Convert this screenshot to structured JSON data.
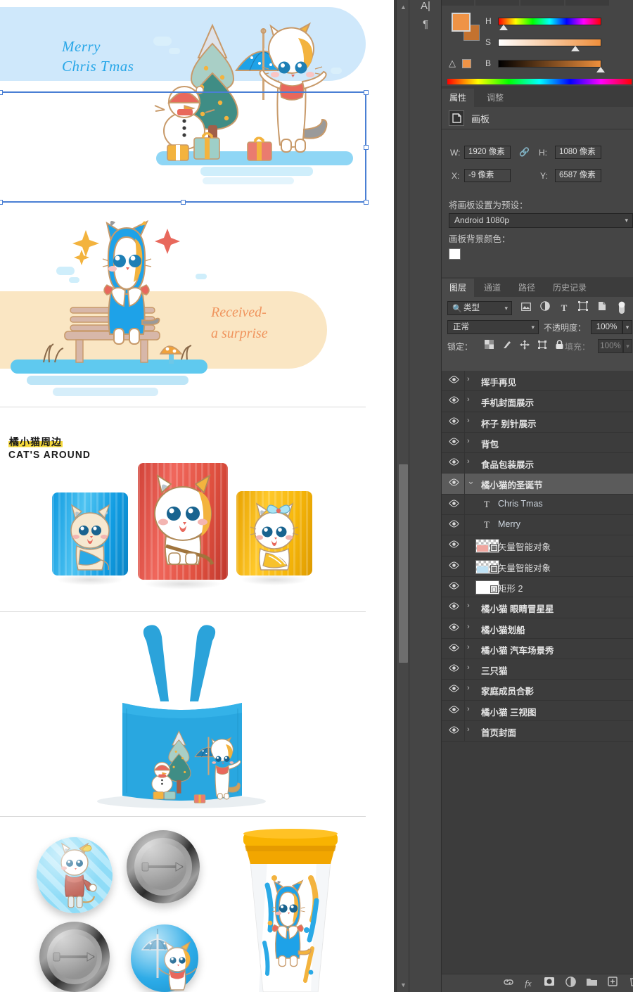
{
  "app": "Adobe Photoshop",
  "dock": {
    "items": [
      {
        "name": "character-panel",
        "glyph": "A|"
      },
      {
        "name": "paragraph-panel",
        "glyph": "¶"
      }
    ]
  },
  "color_panel": {
    "foreground_hex": "#ef9346",
    "background_hex": "#c4722f",
    "out_of_gamut_hex": "#ef9346",
    "channels": [
      {
        "label": "H",
        "value": "24",
        "pct": 7
      },
      {
        "label": "S",
        "value": "75",
        "pct": 75
      },
      {
        "label": "B",
        "value": "100",
        "pct": 100
      }
    ]
  },
  "properties": {
    "tabs": [
      {
        "label": "属性",
        "active": true
      },
      {
        "label": "调整",
        "active": false
      }
    ],
    "header": "画板",
    "fields": {
      "w_label": "W:",
      "w_value": "1920 像素",
      "h_label": "H:",
      "h_value": "1080 像素",
      "x_label": "X:",
      "x_value": "-9 像素",
      "y_label": "Y:",
      "y_value": "6587 像素"
    },
    "preset_label": "将画板设置为预设：",
    "preset_value": "Android 1080p",
    "bgcolor_label": "画板背景颜色：",
    "bgcolor_hex": "#ffffff"
  },
  "layers_panel": {
    "tabs": [
      {
        "label": "图层",
        "active": true
      },
      {
        "label": "通道",
        "active": false
      },
      {
        "label": "路径",
        "active": false
      },
      {
        "label": "历史记录",
        "active": false
      }
    ],
    "filter_value": "类型",
    "filter_icons": [
      "image-filter-icon",
      "adjustment-filter-icon",
      "type-filter-icon",
      "shape-filter-icon",
      "smart-object-filter-icon",
      "toggle-filter-icon"
    ],
    "blend_mode": "正常",
    "opacity_label": "不透明度：",
    "opacity_value": "100%",
    "lock_label": "锁定：",
    "lock_icons": [
      "lock-transparent-icon",
      "lock-image-icon",
      "lock-position-icon",
      "lock-artboard-icon",
      "lock-all-icon"
    ],
    "fill_label": "填充：",
    "fill_value": "100%",
    "rows": [
      {
        "name": "挥手再见",
        "kind": "group",
        "expanded": false,
        "selected": false,
        "visible": true
      },
      {
        "name": "手机封面展示",
        "kind": "group",
        "expanded": false,
        "selected": false,
        "visible": true
      },
      {
        "name": "杯子 别针展示",
        "kind": "group",
        "expanded": false,
        "selected": false,
        "visible": true
      },
      {
        "name": "背包",
        "kind": "group",
        "expanded": false,
        "selected": false,
        "visible": true
      },
      {
        "name": "食品包装展示",
        "kind": "group",
        "expanded": false,
        "selected": false,
        "visible": true
      },
      {
        "name": "橘小猫的圣诞节",
        "kind": "group",
        "expanded": true,
        "selected": true,
        "visible": true
      },
      {
        "name": "Chris Tmas",
        "kind": "text",
        "selected": false,
        "visible": true
      },
      {
        "name": "Merry",
        "kind": "text",
        "selected": false,
        "visible": true
      },
      {
        "name": "矢量智能对象",
        "kind": "smart-object",
        "selected": false,
        "visible": true
      },
      {
        "name": "矢量智能对象",
        "kind": "smart-object",
        "selected": false,
        "visible": true
      },
      {
        "name": "矩形 2",
        "kind": "shape",
        "selected": false,
        "visible": true
      },
      {
        "name": "橘小猫 眼睛冒星星",
        "kind": "group",
        "expanded": false,
        "selected": false,
        "visible": true
      },
      {
        "name": "橘小猫划船",
        "kind": "group",
        "expanded": false,
        "selected": false,
        "visible": true
      },
      {
        "name": "橘小猫 汽车场景秀",
        "kind": "group",
        "expanded": false,
        "selected": false,
        "visible": true
      },
      {
        "name": "三只猫",
        "kind": "group",
        "expanded": false,
        "selected": false,
        "visible": true
      },
      {
        "name": "家庭成员合影",
        "kind": "group",
        "expanded": false,
        "selected": false,
        "visible": true
      },
      {
        "name": "橘小猫 三视图",
        "kind": "group",
        "expanded": false,
        "selected": false,
        "visible": true
      },
      {
        "name": "首页封面",
        "kind": "group",
        "expanded": false,
        "selected": false,
        "visible": true
      }
    ],
    "footer_icons": [
      "link-layers-icon",
      "layer-style-fx-icon",
      "add-mask-icon",
      "adjustment-layer-icon",
      "new-group-icon",
      "new-layer-icon",
      "delete-layer-icon"
    ]
  },
  "canvas": {
    "artboards": [
      {
        "name": "christmas-banner",
        "selected": true,
        "texts": {
          "line1": "Merry",
          "line2": "Chris Tmas"
        },
        "colors": {
          "band": "#cfe8fb",
          "text": "#29a7e8",
          "accent": "#5fc9ef"
        }
      },
      {
        "name": "bench-surprise",
        "texts": {
          "line1": "Received-",
          "line2": "a surprise"
        },
        "colors": {
          "band": "#fae6c3",
          "text": "#f0945d"
        }
      },
      {
        "name": "snack-packaging",
        "texts": {
          "title_cn": "橘小猫周边",
          "title_en": "CAT'S AROUND"
        },
        "packages": [
          {
            "label": "blue-package",
            "hex": "#1eaaeb"
          },
          {
            "label": "red-package",
            "hex": "#e8534a"
          },
          {
            "label": "yellow-package",
            "hex": "#f9b817"
          }
        ]
      },
      {
        "name": "tote-bag",
        "colors": {
          "bag": "#22a8e0"
        }
      },
      {
        "name": "badges-and-cup",
        "badges": [
          {
            "label": "badge-bow-cat",
            "hex": "#6ed2f5"
          },
          {
            "label": "badge-pin-back-top",
            "hex": "#7a7a7a"
          },
          {
            "label": "badge-pin-back-bottom",
            "hex": "#7a7a7a"
          },
          {
            "label": "badge-umbrella-cat",
            "hex": "#2aa9e6"
          }
        ],
        "cup": {
          "lid_hex": "#f0a500",
          "body_hex": "#ffffff"
        }
      }
    ],
    "scrollbar": {
      "up_arrow": "▲",
      "down_arrow": "▼"
    }
  }
}
